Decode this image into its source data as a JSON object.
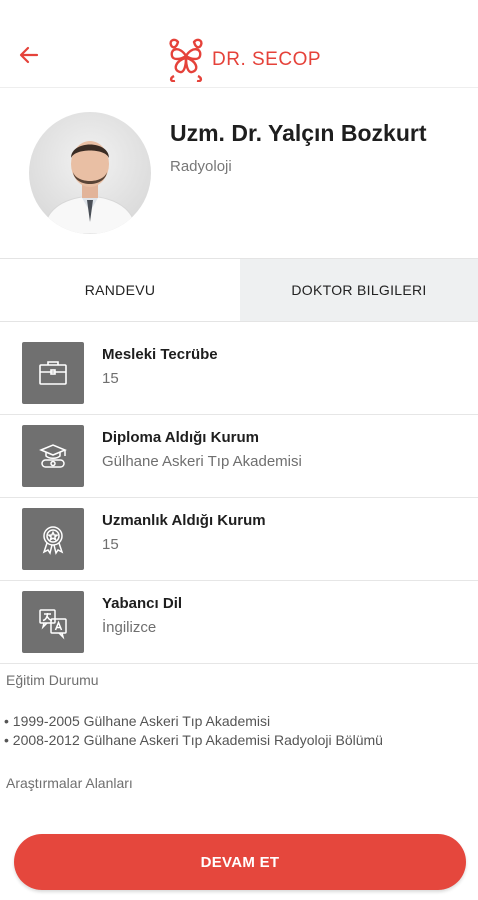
{
  "header": {
    "back_icon": "arrow-left-icon",
    "logo_text": "DR. SECOP",
    "brand_color": "#e5423a"
  },
  "doctor": {
    "name": "Uzm. Dr. Yalçın Bozkurt",
    "department": "Radyoloji"
  },
  "tabs": [
    {
      "label": "RANDEVU",
      "selected": false
    },
    {
      "label": "DOKTOR BILGILERI",
      "selected": true
    }
  ],
  "info_items": [
    {
      "icon": "briefcase-icon",
      "title": "Mesleki Tecrübe",
      "value": "15"
    },
    {
      "icon": "graduation-cap-icon",
      "title": "Diploma Aldığı Kurum",
      "value": "Gülhane Askeri Tıp Akademisi"
    },
    {
      "icon": "award-badge-icon",
      "title": "Uzmanlık Aldığı Kurum",
      "value": "15"
    },
    {
      "icon": "translate-icon",
      "title": "Yabancı Dil",
      "value": "İngilizce"
    }
  ],
  "education": {
    "heading": "Eğitim Durumu",
    "items": [
      "• 1999-2005 Gülhane Askeri Tıp Akademisi",
      "• 2008-2012 Gülhane Askeri Tıp Akademisi Radyoloji Bölümü"
    ]
  },
  "research": {
    "heading": "Araştırmalar Alanları"
  },
  "cta": {
    "label": "DEVAM ET",
    "color": "#e5473d"
  }
}
